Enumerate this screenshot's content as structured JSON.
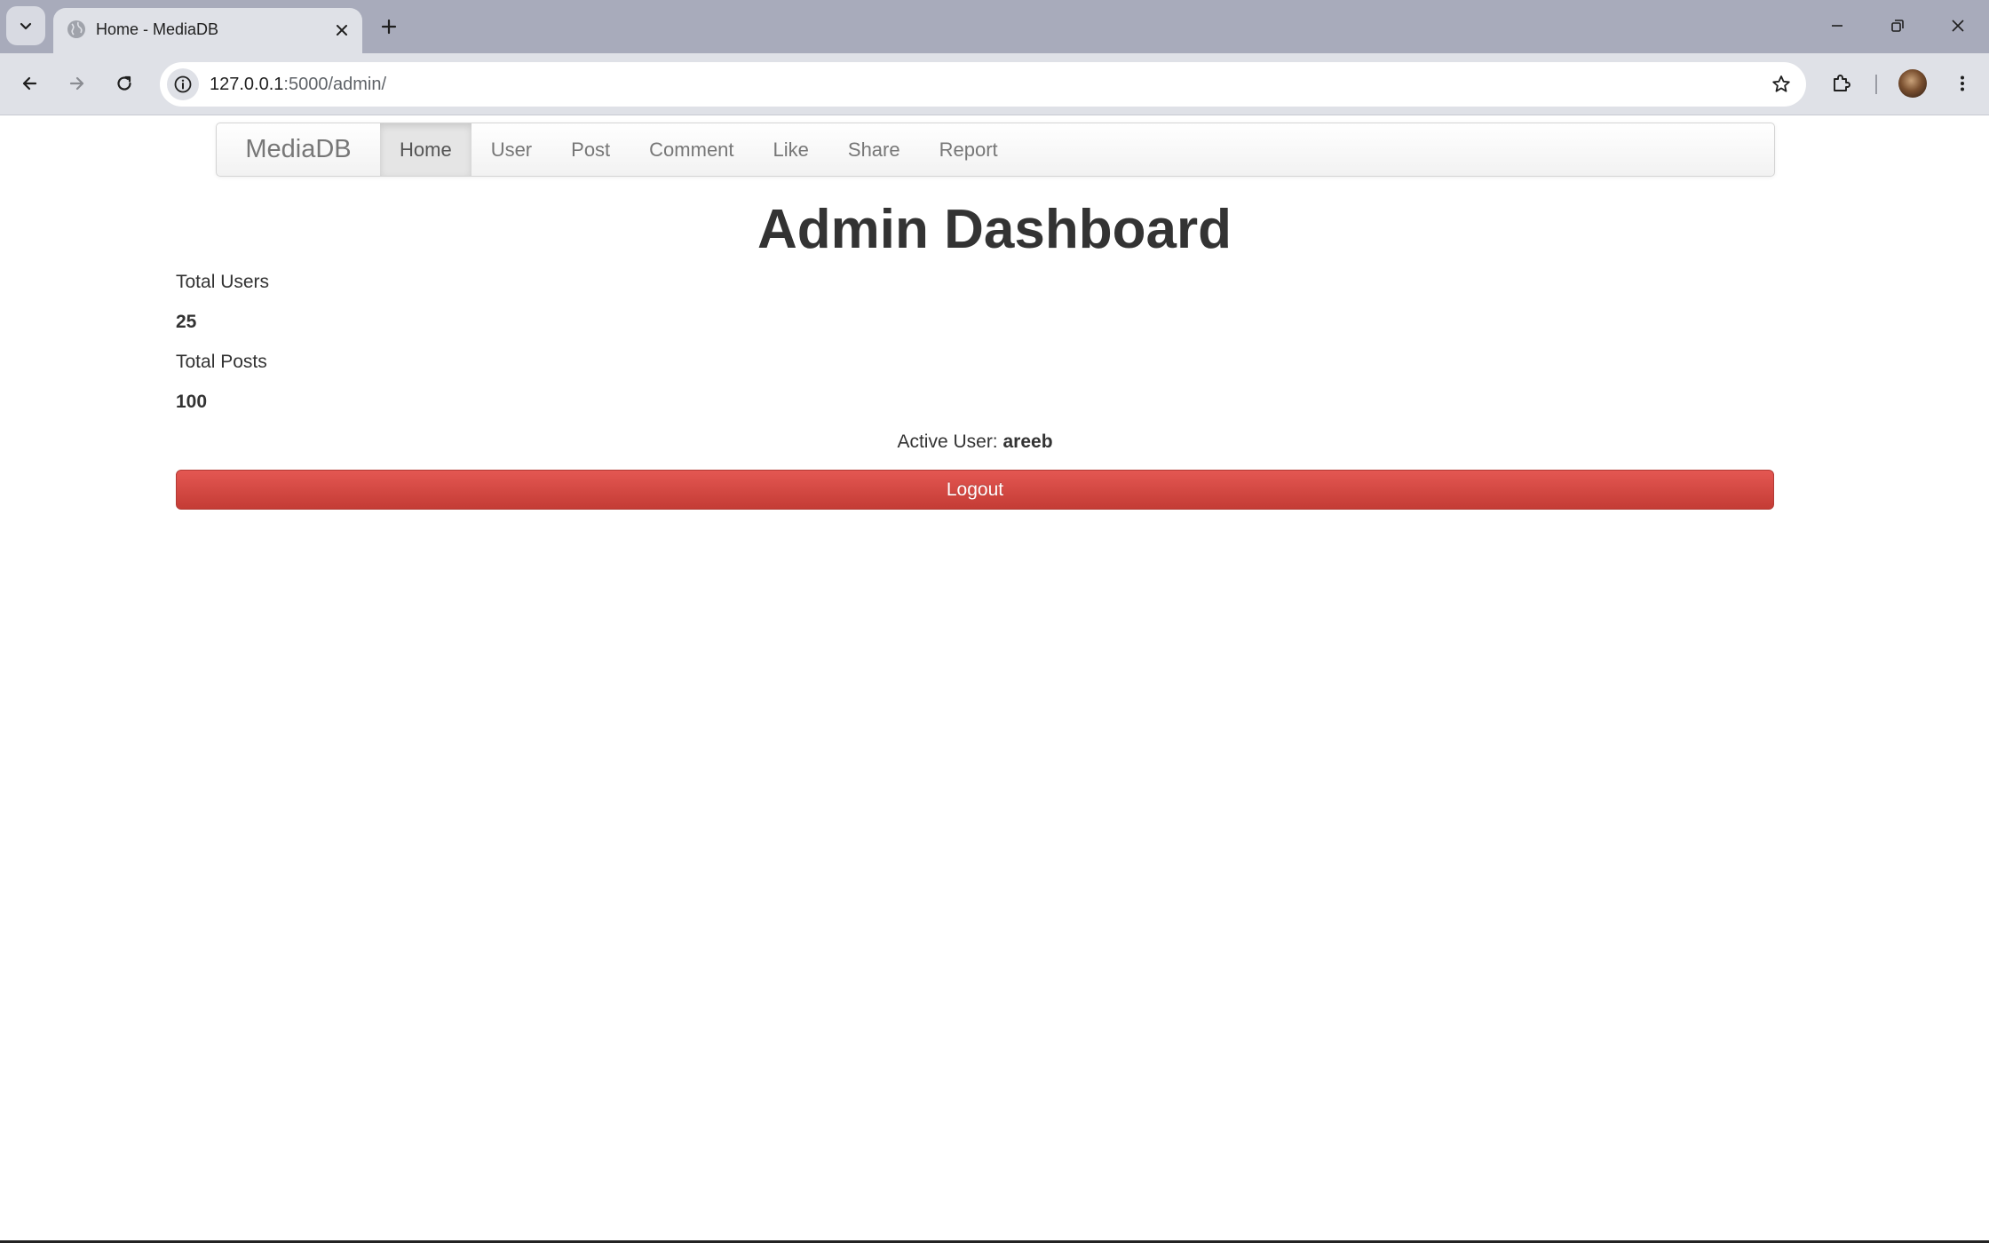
{
  "browser": {
    "tab_title": "Home - MediaDB",
    "url_host": "127.0.0.1",
    "url_path": ":5000/admin/",
    "icons": {
      "tab_search": "chevron-down-icon",
      "favicon": "globe-icon",
      "tab_close": "close-icon",
      "new_tab": "plus-icon",
      "back": "back-arrow-icon",
      "forward": "forward-arrow-icon",
      "reload": "reload-icon",
      "site_info": "info-icon",
      "bookmark": "star-icon",
      "extensions": "puzzle-icon",
      "menu": "kebab-menu-icon",
      "minimize": "minimize-icon",
      "restore": "restore-icon",
      "close_window": "close-icon"
    }
  },
  "navbar": {
    "brand": "MediaDB",
    "items": [
      {
        "label": "Home",
        "active": true
      },
      {
        "label": "User",
        "active": false
      },
      {
        "label": "Post",
        "active": false
      },
      {
        "label": "Comment",
        "active": false
      },
      {
        "label": "Like",
        "active": false
      },
      {
        "label": "Share",
        "active": false
      },
      {
        "label": "Report",
        "active": false
      }
    ]
  },
  "main": {
    "title": "Admin Dashboard",
    "stats": [
      {
        "label": "Total Users",
        "value": "25"
      },
      {
        "label": "Total Posts",
        "value": "100"
      }
    ],
    "active_user_label": "Active User: ",
    "active_user_name": "areeb",
    "logout_label": "Logout"
  },
  "colors": {
    "logout_button": "#da4f49",
    "tabstrip": "#a8abbb",
    "toolbar": "#dfe1e7",
    "text": "#333333"
  }
}
